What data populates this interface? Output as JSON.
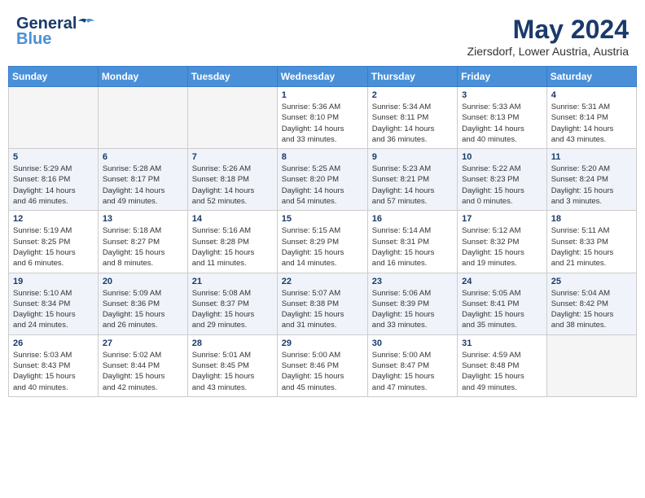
{
  "header": {
    "logo_general": "General",
    "logo_blue": "Blue",
    "month_title": "May 2024",
    "location": "Ziersdorf, Lower Austria, Austria"
  },
  "weekdays": [
    "Sunday",
    "Monday",
    "Tuesday",
    "Wednesday",
    "Thursday",
    "Friday",
    "Saturday"
  ],
  "weeks": [
    [
      {
        "day": "",
        "info": ""
      },
      {
        "day": "",
        "info": ""
      },
      {
        "day": "",
        "info": ""
      },
      {
        "day": "1",
        "info": "Sunrise: 5:36 AM\nSunset: 8:10 PM\nDaylight: 14 hours\nand 33 minutes."
      },
      {
        "day": "2",
        "info": "Sunrise: 5:34 AM\nSunset: 8:11 PM\nDaylight: 14 hours\nand 36 minutes."
      },
      {
        "day": "3",
        "info": "Sunrise: 5:33 AM\nSunset: 8:13 PM\nDaylight: 14 hours\nand 40 minutes."
      },
      {
        "day": "4",
        "info": "Sunrise: 5:31 AM\nSunset: 8:14 PM\nDaylight: 14 hours\nand 43 minutes."
      }
    ],
    [
      {
        "day": "5",
        "info": "Sunrise: 5:29 AM\nSunset: 8:16 PM\nDaylight: 14 hours\nand 46 minutes."
      },
      {
        "day": "6",
        "info": "Sunrise: 5:28 AM\nSunset: 8:17 PM\nDaylight: 14 hours\nand 49 minutes."
      },
      {
        "day": "7",
        "info": "Sunrise: 5:26 AM\nSunset: 8:18 PM\nDaylight: 14 hours\nand 52 minutes."
      },
      {
        "day": "8",
        "info": "Sunrise: 5:25 AM\nSunset: 8:20 PM\nDaylight: 14 hours\nand 54 minutes."
      },
      {
        "day": "9",
        "info": "Sunrise: 5:23 AM\nSunset: 8:21 PM\nDaylight: 14 hours\nand 57 minutes."
      },
      {
        "day": "10",
        "info": "Sunrise: 5:22 AM\nSunset: 8:23 PM\nDaylight: 15 hours\nand 0 minutes."
      },
      {
        "day": "11",
        "info": "Sunrise: 5:20 AM\nSunset: 8:24 PM\nDaylight: 15 hours\nand 3 minutes."
      }
    ],
    [
      {
        "day": "12",
        "info": "Sunrise: 5:19 AM\nSunset: 8:25 PM\nDaylight: 15 hours\nand 6 minutes."
      },
      {
        "day": "13",
        "info": "Sunrise: 5:18 AM\nSunset: 8:27 PM\nDaylight: 15 hours\nand 8 minutes."
      },
      {
        "day": "14",
        "info": "Sunrise: 5:16 AM\nSunset: 8:28 PM\nDaylight: 15 hours\nand 11 minutes."
      },
      {
        "day": "15",
        "info": "Sunrise: 5:15 AM\nSunset: 8:29 PM\nDaylight: 15 hours\nand 14 minutes."
      },
      {
        "day": "16",
        "info": "Sunrise: 5:14 AM\nSunset: 8:31 PM\nDaylight: 15 hours\nand 16 minutes."
      },
      {
        "day": "17",
        "info": "Sunrise: 5:12 AM\nSunset: 8:32 PM\nDaylight: 15 hours\nand 19 minutes."
      },
      {
        "day": "18",
        "info": "Sunrise: 5:11 AM\nSunset: 8:33 PM\nDaylight: 15 hours\nand 21 minutes."
      }
    ],
    [
      {
        "day": "19",
        "info": "Sunrise: 5:10 AM\nSunset: 8:34 PM\nDaylight: 15 hours\nand 24 minutes."
      },
      {
        "day": "20",
        "info": "Sunrise: 5:09 AM\nSunset: 8:36 PM\nDaylight: 15 hours\nand 26 minutes."
      },
      {
        "day": "21",
        "info": "Sunrise: 5:08 AM\nSunset: 8:37 PM\nDaylight: 15 hours\nand 29 minutes."
      },
      {
        "day": "22",
        "info": "Sunrise: 5:07 AM\nSunset: 8:38 PM\nDaylight: 15 hours\nand 31 minutes."
      },
      {
        "day": "23",
        "info": "Sunrise: 5:06 AM\nSunset: 8:39 PM\nDaylight: 15 hours\nand 33 minutes."
      },
      {
        "day": "24",
        "info": "Sunrise: 5:05 AM\nSunset: 8:41 PM\nDaylight: 15 hours\nand 35 minutes."
      },
      {
        "day": "25",
        "info": "Sunrise: 5:04 AM\nSunset: 8:42 PM\nDaylight: 15 hours\nand 38 minutes."
      }
    ],
    [
      {
        "day": "26",
        "info": "Sunrise: 5:03 AM\nSunset: 8:43 PM\nDaylight: 15 hours\nand 40 minutes."
      },
      {
        "day": "27",
        "info": "Sunrise: 5:02 AM\nSunset: 8:44 PM\nDaylight: 15 hours\nand 42 minutes."
      },
      {
        "day": "28",
        "info": "Sunrise: 5:01 AM\nSunset: 8:45 PM\nDaylight: 15 hours\nand 43 minutes."
      },
      {
        "day": "29",
        "info": "Sunrise: 5:00 AM\nSunset: 8:46 PM\nDaylight: 15 hours\nand 45 minutes."
      },
      {
        "day": "30",
        "info": "Sunrise: 5:00 AM\nSunset: 8:47 PM\nDaylight: 15 hours\nand 47 minutes."
      },
      {
        "day": "31",
        "info": "Sunrise: 4:59 AM\nSunset: 8:48 PM\nDaylight: 15 hours\nand 49 minutes."
      },
      {
        "day": "",
        "info": ""
      }
    ]
  ]
}
